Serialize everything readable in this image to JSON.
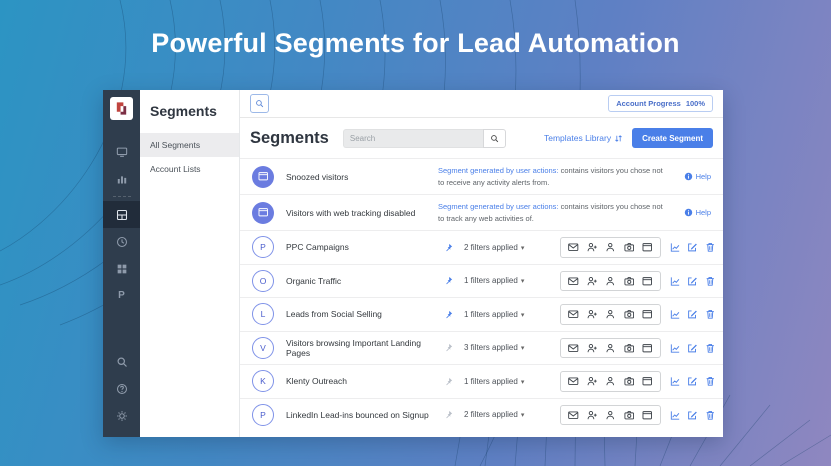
{
  "hero": {
    "title": "Powerful Segments for Lead Automation"
  },
  "app": {
    "rail": {
      "p_label": "P",
      "icons": [
        "screen-icon",
        "bar-chart-icon",
        "segments-icon",
        "clock-icon",
        "apps-grid-icon",
        "p-letter"
      ],
      "bottom_icons": [
        "search-icon",
        "help-icon",
        "settings-icon"
      ]
    },
    "nav_panel": {
      "title": "Segments",
      "items": [
        {
          "label": "All Segments",
          "active": true
        },
        {
          "label": "Account Lists",
          "active": false
        }
      ]
    },
    "topbar": {
      "account_progress_label": "Account Progress",
      "account_progress_value": "100%"
    },
    "header": {
      "title": "Segments",
      "search_placeholder": "Search",
      "templates_library": "Templates Library",
      "create_segment": "Create Segment"
    },
    "system_rows": [
      {
        "name": "Snoozed visitors",
        "desc_link": "Segment generated by user actions:",
        "desc_rest": " contains visitors you chose not to receive any activity alerts from.",
        "help": "Help"
      },
      {
        "name": "Visitors with web tracking disabled",
        "desc_link": "Segment generated by user actions:",
        "desc_rest": " contains visitors you chose not to track any web activities of.",
        "help": "Help"
      }
    ],
    "segment_rows": [
      {
        "initial": "P",
        "name": "PPC Campaigns",
        "pinned": true,
        "filters": "2 filters applied"
      },
      {
        "initial": "O",
        "name": "Organic Traffic",
        "pinned": true,
        "filters": "1 filters applied"
      },
      {
        "initial": "L",
        "name": "Leads from Social Selling",
        "pinned": true,
        "filters": "1 filters applied"
      },
      {
        "initial": "V",
        "name": "Visitors browsing Important Landing Pages",
        "pinned": false,
        "filters": "3 filters applied"
      },
      {
        "initial": "K",
        "name": "Klenty Outreach",
        "pinned": false,
        "filters": "1 filters applied"
      },
      {
        "initial": "P",
        "name": "LinkedIn Lead-ins bounced on Signup",
        "pinned": false,
        "filters": "2 filters applied"
      }
    ],
    "row_action_icons": [
      "email-icon",
      "add-person-icon",
      "person-icon",
      "camera-icon",
      "window-icon",
      "analytics-icon",
      "edit-icon",
      "delete-icon"
    ],
    "colors": {
      "accent_blue": "#4a7fe8",
      "avatar_purple": "#6b7ce0",
      "rail_dark": "#2f3d4d",
      "gradient_start": "#2c94c3",
      "gradient_end": "#8f87c0",
      "logo_red": "#c0443f",
      "logo_maroon": "#7c2f45"
    }
  }
}
